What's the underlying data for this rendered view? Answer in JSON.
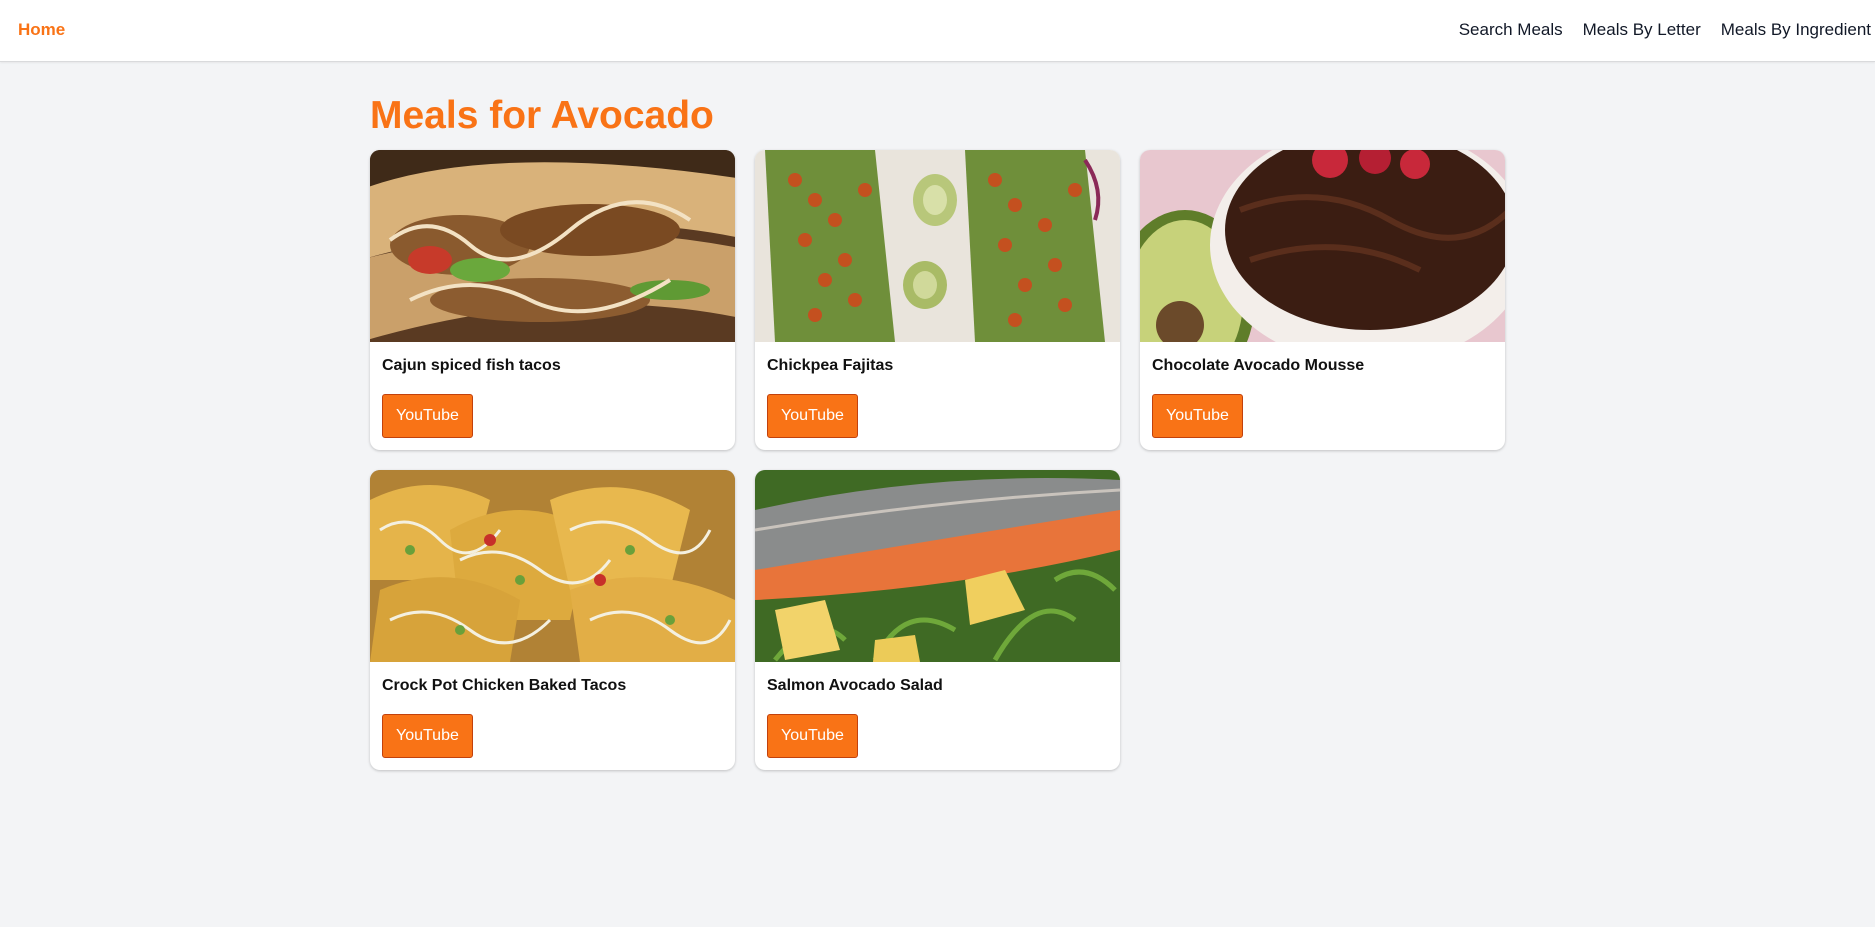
{
  "header": {
    "home_label": "Home",
    "nav": [
      {
        "label": "Search Meals"
      },
      {
        "label": "Meals By Letter"
      },
      {
        "label": "Meals By Ingredient"
      }
    ]
  },
  "page": {
    "title": "Meals for Avocado"
  },
  "meals": [
    {
      "name": "Cajun spiced fish tacos",
      "button_label": "YouTube",
      "image": "fish-tacos-photo"
    },
    {
      "name": "Chickpea Fajitas",
      "button_label": "YouTube",
      "image": "chickpea-fajitas-photo"
    },
    {
      "name": "Chocolate Avocado Mousse",
      "button_label": "YouTube",
      "image": "chocolate-mousse-photo"
    },
    {
      "name": "Crock Pot Chicken Baked Tacos",
      "button_label": "YouTube",
      "image": "baked-tacos-photo"
    },
    {
      "name": "Salmon Avocado Salad",
      "button_label": "YouTube",
      "image": "salmon-salad-photo"
    }
  ],
  "colors": {
    "accent": "#f97316",
    "page_background": "#f3f4f6",
    "card_background": "#ffffff"
  }
}
